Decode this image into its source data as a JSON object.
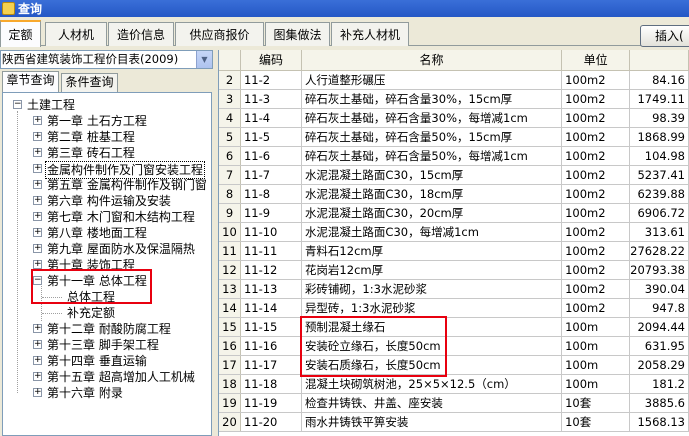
{
  "window": {
    "title": "查询"
  },
  "tabs": [
    {
      "label": "定额",
      "active": true
    },
    {
      "label": "人材机",
      "active": false
    },
    {
      "label": "造价信息",
      "active": false
    },
    {
      "label": "供应商报价",
      "active": false
    },
    {
      "label": "图集做法",
      "active": false
    },
    {
      "label": "补充人材机",
      "active": false
    }
  ],
  "toolbar": {
    "insert_label": "插入("
  },
  "left": {
    "library_selected": "陕西省建筑装饰工程价目表(2009)",
    "subtabs": [
      "章节查询",
      "条件查询"
    ],
    "tree": {
      "root": "土建工程",
      "chapters": [
        "第一章 土石方工程",
        "第二章 桩基工程",
        "第三章 砖石工程",
        "金属构件制作及门窗安装工程",
        "第五章 金属构件制作及钢门窗",
        "第六章 构件运输及安装",
        "第七章 木门窗和木结构工程",
        "第八章 楼地面工程",
        "第九章 屋面防水及保温隔热",
        "第十章 装饰工程",
        "第十一章 总体工程",
        "第十二章 耐酸防腐工程",
        "第十三章 脚手架工程",
        "第十四章 垂直运输",
        "第十五章 超高增加人工机械",
        "第十六章 附录"
      ],
      "expanded_children": [
        "总体工程",
        "补充定额"
      ]
    }
  },
  "grid": {
    "columns": [
      "编码",
      "名称",
      "单位",
      ""
    ],
    "rows": [
      {
        "n": "2",
        "code": "11-2",
        "name": "人行道整形碾压",
        "unit": "100m2",
        "price": "84.16"
      },
      {
        "n": "3",
        "code": "11-3",
        "name": "碎石灰土基础，碎石含量30%，15cm厚",
        "unit": "100m2",
        "price": "1749.11"
      },
      {
        "n": "4",
        "code": "11-4",
        "name": "碎石灰土基础，碎石含量30%，每增减1cm",
        "unit": "100m2",
        "price": "98.39"
      },
      {
        "n": "5",
        "code": "11-5",
        "name": "碎石灰土基础，碎石含量50%，15cm厚",
        "unit": "100m2",
        "price": "1868.99"
      },
      {
        "n": "6",
        "code": "11-6",
        "name": "碎石灰土基础，碎石含量50%，每增减1cm",
        "unit": "100m2",
        "price": "104.98"
      },
      {
        "n": "7",
        "code": "11-7",
        "name": "水泥混凝土路面C30，15cm厚",
        "unit": "100m2",
        "price": "5237.41"
      },
      {
        "n": "8",
        "code": "11-8",
        "name": "水泥混凝土路面C30，18cm厚",
        "unit": "100m2",
        "price": "6239.88"
      },
      {
        "n": "9",
        "code": "11-9",
        "name": "水泥混凝土路面C30，20cm厚",
        "unit": "100m2",
        "price": "6906.72"
      },
      {
        "n": "10",
        "code": "11-10",
        "name": "水泥混凝土路面C30，每增减1cm",
        "unit": "100m2",
        "price": "313.61"
      },
      {
        "n": "11",
        "code": "11-11",
        "name": "青料石12cm厚",
        "unit": "100m2",
        "price": "27628.22"
      },
      {
        "n": "12",
        "code": "11-12",
        "name": "花岗岩12cm厚",
        "unit": "100m2",
        "price": "20793.38"
      },
      {
        "n": "13",
        "code": "11-13",
        "name": "彩砖铺砌，1:3水泥砂浆",
        "unit": "100m2",
        "price": "390.04"
      },
      {
        "n": "14",
        "code": "11-14",
        "name": "异型砖，1:3水泥砂浆",
        "unit": "100m2",
        "price": "947.8"
      },
      {
        "n": "15",
        "code": "11-15",
        "name": "预制混凝土缘石",
        "unit": "100m",
        "price": "2094.44"
      },
      {
        "n": "16",
        "code": "11-16",
        "name": "安装砼立缘石，长度50cm",
        "unit": "100m",
        "price": "631.95"
      },
      {
        "n": "17",
        "code": "11-17",
        "name": "安装石质缘石，长度50cm",
        "unit": "100m",
        "price": "2058.29"
      },
      {
        "n": "18",
        "code": "11-18",
        "name": "混凝土块砌筑树池，25×5×12.5（cm）",
        "unit": "100m",
        "price": "181.2"
      },
      {
        "n": "19",
        "code": "11-19",
        "name": "检查井铸铁、井盖、座安装",
        "unit": "10套",
        "price": "3885.6"
      },
      {
        "n": "20",
        "code": "11-20",
        "name": "雨水井铸铁平箅安装",
        "unit": "10套",
        "price": "1568.13"
      }
    ]
  },
  "colors": {
    "highlight": "#e8000f",
    "tab_accent": "#f8a82c",
    "title_bar": "#2457c5"
  }
}
